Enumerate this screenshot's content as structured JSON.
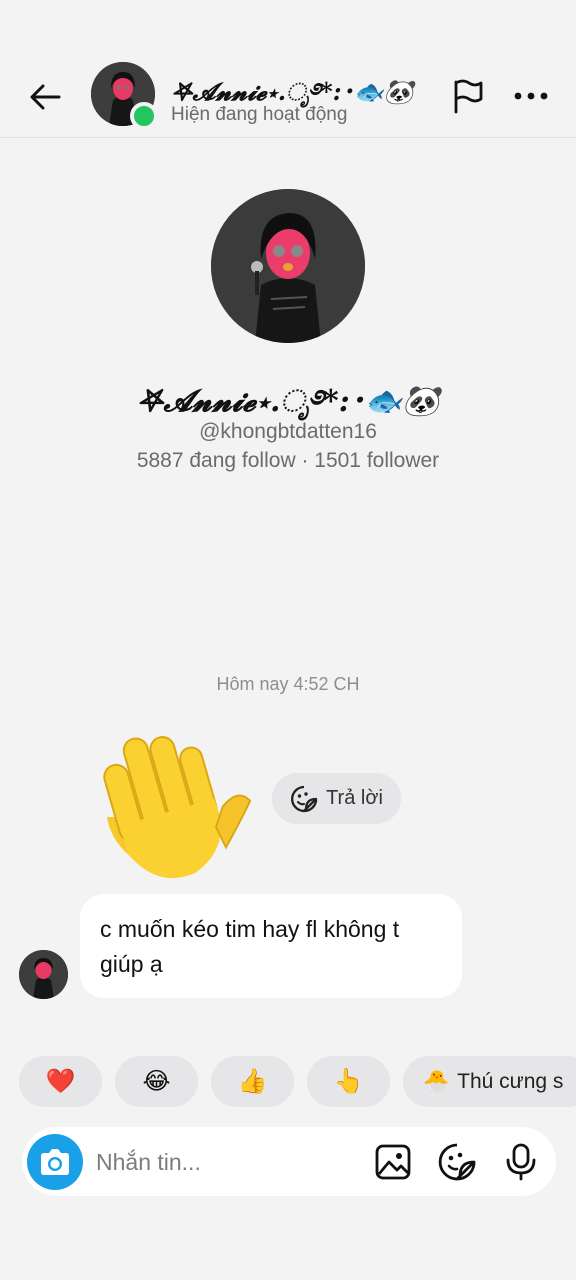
{
  "header": {
    "name": "𖤐𝓐𝓷𝓷𝓲𝓮⋆.ೃ࿔*:･🐟🐼",
    "status": "Hiện đang hoạt động",
    "icons": [
      "back-arrow-icon",
      "flag-icon",
      "more-dots-icon"
    ]
  },
  "profile": {
    "name": "𖤐𝓐𝓷𝓷𝓲𝓮⋆.ೃ࿔*:･🐟🐼",
    "handle": "@khongbtdatten16",
    "stats": "5887 đang follow · 1501 follower"
  },
  "chat": {
    "timestamp": "Hôm nay 4:52 CH",
    "wave_emoji": "👋",
    "reply_label": "Trả lời",
    "message": "c muốn kéo tim hay fl không t giúp ạ"
  },
  "quick_replies": [
    {
      "emoji": "❤️"
    },
    {
      "emoji": "😂"
    },
    {
      "emoji": "👍"
    },
    {
      "emoji": "👆"
    },
    {
      "emoji": "🐣",
      "label": "Thú cưng s"
    }
  ],
  "composer": {
    "placeholder": "Nhắn tin..."
  },
  "colors": {
    "background": "#f3f3f4",
    "online": "#22c55e",
    "camera": "#1aa0e6",
    "bubble": "#ffffff"
  }
}
